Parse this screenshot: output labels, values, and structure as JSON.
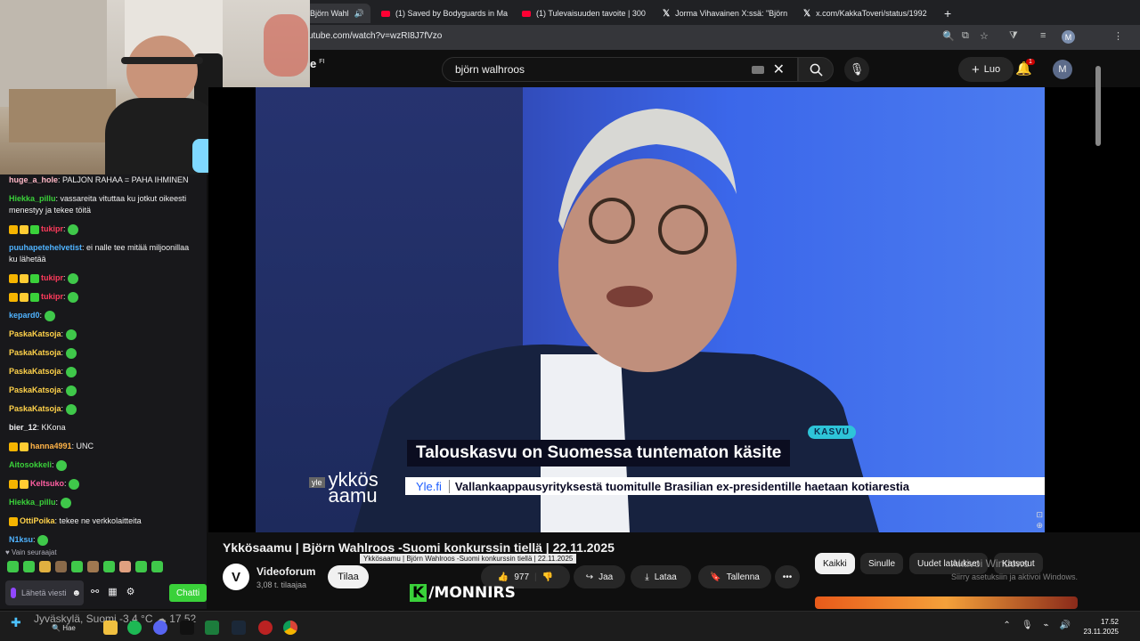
{
  "browser": {
    "tabs": [
      {
        "label": "Björn Wahl",
        "type": "yt",
        "active": true
      },
      {
        "label": "(1) Saved by Bodyguards in Ma",
        "type": "yt"
      },
      {
        "label": "(1) Tulevaisuuden tavoite | 300",
        "type": "yt"
      },
      {
        "label": "Jorma Vihavainen X:ssä: \"Björn",
        "type": "x"
      },
      {
        "label": "x.com/KakkaToveri/status/1992",
        "type": "x"
      }
    ],
    "new_tab": "+",
    "url": "utube.com/watch?v=wzRI8J7fVzo",
    "profile_initial": "M"
  },
  "youtube": {
    "logo_suffix": "FI",
    "search_value": "björn walhroos",
    "create_label": "Luo",
    "notif_count": "1",
    "avatar_initial": "M"
  },
  "video": {
    "badge": "KASVU",
    "headline": "Talouskasvu on Suomessa tuntematon käsite",
    "logo_tag": "yle",
    "logo_line1": "ykkös",
    "logo_line2": "aamu",
    "ticker_source": "Yle.fi",
    "ticker_text": "Vallankaappausyrityksestä tuomitulle Brasilian ex-presidentille haetaan kotiarestia",
    "title": "Ykkösaamu | Björn Wahlroos -Suomi konkurssin tiellä | 22.11.2025",
    "tooltip": "Ykkösaamu | Björn Wahlroos -Suomi konkurssin tiellä | 22.11.2025",
    "channel": "Videoforum",
    "subs": "3,08 t. tilaajaa",
    "subscribe": "Tilaa",
    "likes": "977",
    "share": "Jaa",
    "download": "Lataa",
    "save": "Tallenna",
    "watermark": "/MONNIRS",
    "watermark_k": "K"
  },
  "chips": [
    "Kaikki",
    "Sinulle",
    "Uudet lataukset",
    "Katsotut"
  ],
  "activate_windows": {
    "line1": "Aktivoi Windows",
    "line2": "Siirry asetuksiin ja aktivoi Windows."
  },
  "chat": {
    "messages": [
      {
        "user": "huge_a_hole",
        "color": "#ffb8c6",
        "text": "PALJON RAHAA = PAHA IHMINEN"
      },
      {
        "user": "Hiekka_pillu",
        "color": "#3ad13a",
        "text": "vassareita vituttaa ku jotkut oikeesti menestyy ja tekee töitä"
      },
      {
        "user": "tukipr",
        "color": "#ff3b5c",
        "text": "",
        "badges": 3,
        "emote": true
      },
      {
        "user": "puuhapetehelvetist",
        "color": "#4fb3ff",
        "text": "ei nalle tee mitää miljoonillaa ku lähetää"
      },
      {
        "user": "tukipr",
        "color": "#ff3b5c",
        "text": "",
        "badges": 3,
        "emote": true
      },
      {
        "user": "tukipr",
        "color": "#ff3b5c",
        "text": "",
        "badges": 3,
        "emote": true
      },
      {
        "user": "kepard0",
        "color": "#4fb3ff",
        "text": "",
        "emote": true
      },
      {
        "user": "PaskaKatsoja",
        "color": "#ffd24a",
        "text": "",
        "emote": true
      },
      {
        "user": "PaskaKatsoja",
        "color": "#ffd24a",
        "text": "",
        "emote": true
      },
      {
        "user": "PaskaKatsoja",
        "color": "#ffd24a",
        "text": "",
        "emote": true
      },
      {
        "user": "PaskaKatsoja",
        "color": "#ffd24a",
        "text": "",
        "emote": true
      },
      {
        "user": "PaskaKatsoja",
        "color": "#ffd24a",
        "text": "",
        "emote": true
      },
      {
        "user": "bier_12",
        "color": "#efeff1",
        "text": "KKona"
      },
      {
        "user": "hanna4991",
        "color": "#ffb347",
        "text": "UNC",
        "badges": 2
      },
      {
        "user": "Aitosokkeli",
        "color": "#3ad13a",
        "text": "",
        "emote": true
      },
      {
        "user": "Keltsuko",
        "color": "#ff5fa2",
        "text": "",
        "badges": 2,
        "emote": true
      },
      {
        "user": "Hiekka_pillu",
        "color": "#3ad13a",
        "text": "",
        "emote": true
      },
      {
        "user": "OttiPoika",
        "color": "#ffd24a",
        "text": "tekee ne verkkolaitteita",
        "badges": 1
      },
      {
        "user": "N1ksu",
        "color": "#4fb3ff",
        "text": "",
        "emote": true
      }
    ],
    "follow_note": "Vain seuraajat",
    "input_placeholder": "Lähetä viesti",
    "send": "Chatti"
  },
  "taskbar": {
    "weather": "Jyväskylä, Suomi  -3,4 °C",
    "search": "Hae",
    "time": "17.52",
    "date": "23.11.2025",
    "weather_time": "17.52"
  },
  "colors": {
    "yt_red": "#ff0033",
    "twitch_green": "#3ad13a",
    "bg": "#0f0f0f"
  }
}
